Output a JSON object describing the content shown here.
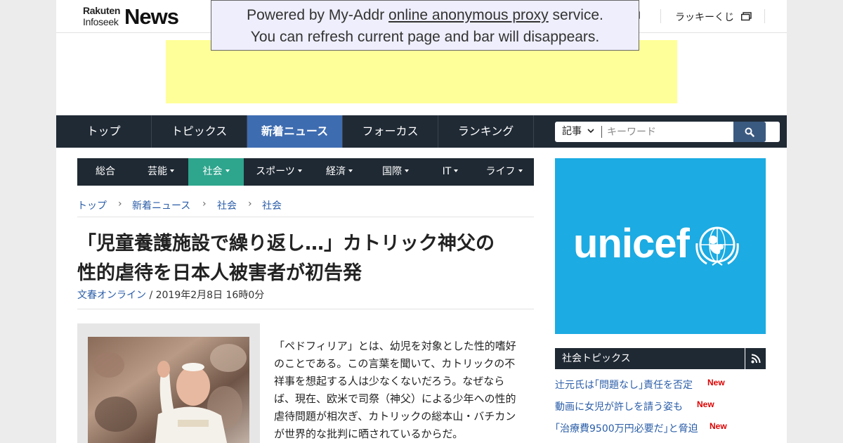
{
  "header": {
    "logo_top": "Rakuten",
    "logo_bottom": "Infoseek",
    "logo_news": "News",
    "lucky_lottery": "ラッキーくじ"
  },
  "proxy_banner": {
    "line1_prefix": "Powered by My-Addr ",
    "line1_link": "online anonymous proxy",
    "line1_suffix": " service.",
    "line2": "You can refresh current page and bar will disappears."
  },
  "main_nav": {
    "items": [
      {
        "label": "トップ"
      },
      {
        "label": "トピックス"
      },
      {
        "label": "新着ニュース",
        "active": true
      },
      {
        "label": "フォーカス"
      },
      {
        "label": "ランキング"
      }
    ],
    "search_category": "記事",
    "search_placeholder": "キーワード"
  },
  "sub_nav": {
    "items": [
      {
        "label": "総合"
      },
      {
        "label": "芸能"
      },
      {
        "label": "社会",
        "active": true
      },
      {
        "label": "スポーツ"
      },
      {
        "label": "経済"
      },
      {
        "label": "国際"
      },
      {
        "label": "IT"
      },
      {
        "label": "ライフ"
      }
    ]
  },
  "breadcrumb": [
    "トップ",
    "新着ニュース",
    "社会",
    "社会"
  ],
  "article": {
    "title_line1": "「児童養護施設で繰り返し…」カトリック神父の",
    "title_line2": "性的虐待を日本人被害者が初告発",
    "source": "文春オンライン",
    "date": " / 2019年2月8日 16時0分",
    "body_lines": [
      "「ペドフィリア」とは、幼児を対象とした性的嗜好",
      "のことである。この言葉を聞いて、カトリックの不",
      "祥事を想起する人は少なくないだろう。なぜなら",
      "ば、現在、欧米で司祭（神父）による少年への性的",
      "虐待問題が相次ぎ、カトリックの総本山・バチカン",
      "が世界的な批判に晒されているからだ。"
    ]
  },
  "sidebar": {
    "ad_word": "unicef",
    "topics_title": "社会トピックス",
    "topics": [
      {
        "text": "辻元氏は｢問題なし｣責任を否定",
        "badge": "New"
      },
      {
        "text": "動画に女児が許しを請う姿も",
        "badge": "New"
      },
      {
        "text": "｢治療費9500万円必要だ｣と脅迫",
        "badge": "New"
      }
    ]
  },
  "colors": {
    "nav_bg": "#202a35",
    "nav_active": "#3e6cb0",
    "subnav_active": "#2ea58d",
    "link": "#2a5da8",
    "unicef_blue": "#1cabe2",
    "ad_yellow": "#ffff99",
    "new_badge": "#dd0000"
  }
}
